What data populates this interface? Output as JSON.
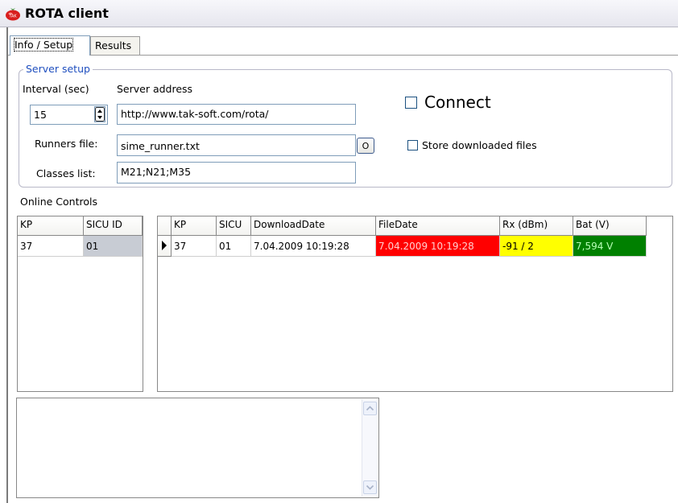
{
  "window": {
    "title": "ROTA client",
    "icon": "tomato-app-icon"
  },
  "tabs": [
    {
      "label": "Info / Setup",
      "active": true
    },
    {
      "label": "Results",
      "active": false
    }
  ],
  "server_setup": {
    "legend": "Server setup",
    "interval_label": "Interval (sec)",
    "interval_value": "15",
    "server_address_label": "Server address",
    "server_address_value": "http://www.tak-soft.com/rota/",
    "runners_file_label": "Runners file:",
    "runners_file_value": "sime_runner.txt",
    "browse_button_label": "O",
    "classes_list_label": "Classes list:",
    "classes_list_value": "M21;N21;M35",
    "connect_label": "Connect",
    "connect_checked": false,
    "store_label": "Store downloaded files",
    "store_checked": false
  },
  "online_controls": {
    "label": "Online Controls",
    "controls_grid": {
      "columns": [
        "KP",
        "SICU ID"
      ],
      "rows": [
        [
          "37",
          "01"
        ]
      ]
    },
    "results_grid": {
      "columns": [
        "KP",
        "SICU",
        "DownloadDate",
        "FileDate",
        "Rx (dBm)",
        "Bat (V)"
      ],
      "rows": [
        {
          "kp": "37",
          "sicu": "01",
          "download_date": "7.04.2009 10:19:28",
          "file_date": "7.04.2009 10:19:28",
          "rx": "-91 / 2",
          "bat": "7,594 V"
        }
      ],
      "cell_colors": {
        "file_date": "#ff0000",
        "rx": "#ffff00",
        "bat": "#008000"
      }
    }
  },
  "memo": {
    "text": ""
  }
}
